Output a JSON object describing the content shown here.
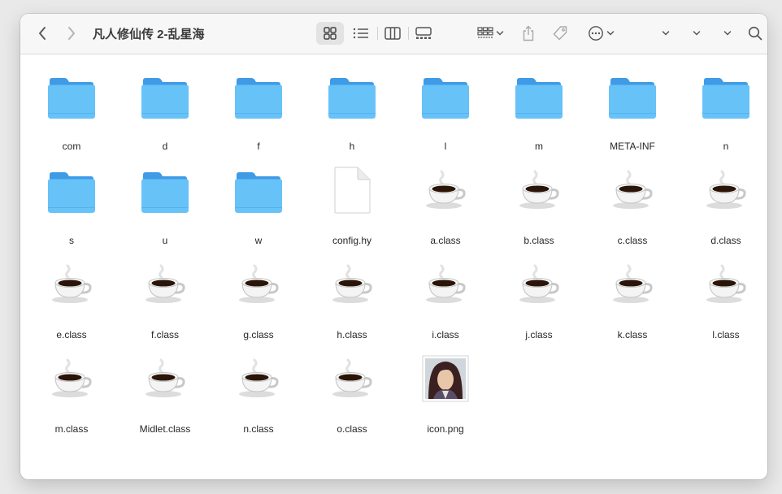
{
  "window": {
    "title": "凡人修仙传 2-乱星海"
  },
  "toolbar": {
    "back": "chevron-left-icon",
    "forward": "chevron-right-icon",
    "views": [
      "icon-view",
      "list-view",
      "column-view",
      "gallery-view"
    ],
    "active_view": "icon-view"
  },
  "colors": {
    "folder_back": "#3f9be6",
    "folder_front": "#67c2f8",
    "accent_text": "#262626"
  },
  "files": [
    {
      "name": "com",
      "kind": "folder"
    },
    {
      "name": "d",
      "kind": "folder"
    },
    {
      "name": "f",
      "kind": "folder"
    },
    {
      "name": "h",
      "kind": "folder"
    },
    {
      "name": "l",
      "kind": "folder"
    },
    {
      "name": "m",
      "kind": "folder"
    },
    {
      "name": "META-INF",
      "kind": "folder"
    },
    {
      "name": "n",
      "kind": "folder"
    },
    {
      "name": "s",
      "kind": "folder"
    },
    {
      "name": "u",
      "kind": "folder"
    },
    {
      "name": "w",
      "kind": "folder"
    },
    {
      "name": "config.hy",
      "kind": "document"
    },
    {
      "name": "a.class",
      "kind": "java-class"
    },
    {
      "name": "b.class",
      "kind": "java-class"
    },
    {
      "name": "c.class",
      "kind": "java-class"
    },
    {
      "name": "d.class",
      "kind": "java-class"
    },
    {
      "name": "e.class",
      "kind": "java-class"
    },
    {
      "name": "f.class",
      "kind": "java-class"
    },
    {
      "name": "g.class",
      "kind": "java-class"
    },
    {
      "name": "h.class",
      "kind": "java-class"
    },
    {
      "name": "i.class",
      "kind": "java-class"
    },
    {
      "name": "j.class",
      "kind": "java-class"
    },
    {
      "name": "k.class",
      "kind": "java-class"
    },
    {
      "name": "l.class",
      "kind": "java-class"
    },
    {
      "name": "m.class",
      "kind": "java-class"
    },
    {
      "name": "Midlet.class",
      "kind": "java-class"
    },
    {
      "name": "n.class",
      "kind": "java-class"
    },
    {
      "name": "o.class",
      "kind": "java-class"
    },
    {
      "name": "icon.png",
      "kind": "image"
    }
  ]
}
